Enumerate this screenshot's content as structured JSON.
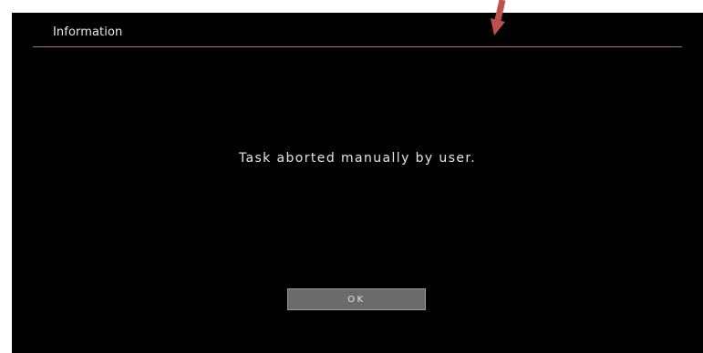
{
  "dialog": {
    "title": "Information",
    "message": "Task aborted manually by user.",
    "ok_label": "OK"
  },
  "colors": {
    "dialog_background": "#000000",
    "divider": "#a57962",
    "button_background": "#6b6b6b",
    "annotation_arrow": "#c0504d"
  },
  "icons": {
    "annotation": "red-arrow-icon"
  }
}
